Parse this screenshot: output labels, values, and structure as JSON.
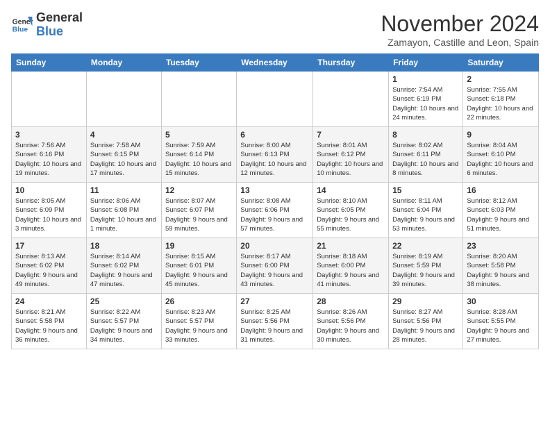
{
  "logo": {
    "line1": "General",
    "line2": "Blue"
  },
  "title": "November 2024",
  "location": "Zamayon, Castille and Leon, Spain",
  "days_of_week": [
    "Sunday",
    "Monday",
    "Tuesday",
    "Wednesday",
    "Thursday",
    "Friday",
    "Saturday"
  ],
  "weeks": [
    [
      {
        "day": "",
        "info": ""
      },
      {
        "day": "",
        "info": ""
      },
      {
        "day": "",
        "info": ""
      },
      {
        "day": "",
        "info": ""
      },
      {
        "day": "",
        "info": ""
      },
      {
        "day": "1",
        "info": "Sunrise: 7:54 AM\nSunset: 6:19 PM\nDaylight: 10 hours and 24 minutes."
      },
      {
        "day": "2",
        "info": "Sunrise: 7:55 AM\nSunset: 6:18 PM\nDaylight: 10 hours and 22 minutes."
      }
    ],
    [
      {
        "day": "3",
        "info": "Sunrise: 7:56 AM\nSunset: 6:16 PM\nDaylight: 10 hours and 19 minutes."
      },
      {
        "day": "4",
        "info": "Sunrise: 7:58 AM\nSunset: 6:15 PM\nDaylight: 10 hours and 17 minutes."
      },
      {
        "day": "5",
        "info": "Sunrise: 7:59 AM\nSunset: 6:14 PM\nDaylight: 10 hours and 15 minutes."
      },
      {
        "day": "6",
        "info": "Sunrise: 8:00 AM\nSunset: 6:13 PM\nDaylight: 10 hours and 12 minutes."
      },
      {
        "day": "7",
        "info": "Sunrise: 8:01 AM\nSunset: 6:12 PM\nDaylight: 10 hours and 10 minutes."
      },
      {
        "day": "8",
        "info": "Sunrise: 8:02 AM\nSunset: 6:11 PM\nDaylight: 10 hours and 8 minutes."
      },
      {
        "day": "9",
        "info": "Sunrise: 8:04 AM\nSunset: 6:10 PM\nDaylight: 10 hours and 6 minutes."
      }
    ],
    [
      {
        "day": "10",
        "info": "Sunrise: 8:05 AM\nSunset: 6:09 PM\nDaylight: 10 hours and 3 minutes."
      },
      {
        "day": "11",
        "info": "Sunrise: 8:06 AM\nSunset: 6:08 PM\nDaylight: 10 hours and 1 minute."
      },
      {
        "day": "12",
        "info": "Sunrise: 8:07 AM\nSunset: 6:07 PM\nDaylight: 9 hours and 59 minutes."
      },
      {
        "day": "13",
        "info": "Sunrise: 8:08 AM\nSunset: 6:06 PM\nDaylight: 9 hours and 57 minutes."
      },
      {
        "day": "14",
        "info": "Sunrise: 8:10 AM\nSunset: 6:05 PM\nDaylight: 9 hours and 55 minutes."
      },
      {
        "day": "15",
        "info": "Sunrise: 8:11 AM\nSunset: 6:04 PM\nDaylight: 9 hours and 53 minutes."
      },
      {
        "day": "16",
        "info": "Sunrise: 8:12 AM\nSunset: 6:03 PM\nDaylight: 9 hours and 51 minutes."
      }
    ],
    [
      {
        "day": "17",
        "info": "Sunrise: 8:13 AM\nSunset: 6:02 PM\nDaylight: 9 hours and 49 minutes."
      },
      {
        "day": "18",
        "info": "Sunrise: 8:14 AM\nSunset: 6:02 PM\nDaylight: 9 hours and 47 minutes."
      },
      {
        "day": "19",
        "info": "Sunrise: 8:15 AM\nSunset: 6:01 PM\nDaylight: 9 hours and 45 minutes."
      },
      {
        "day": "20",
        "info": "Sunrise: 8:17 AM\nSunset: 6:00 PM\nDaylight: 9 hours and 43 minutes."
      },
      {
        "day": "21",
        "info": "Sunrise: 8:18 AM\nSunset: 6:00 PM\nDaylight: 9 hours and 41 minutes."
      },
      {
        "day": "22",
        "info": "Sunrise: 8:19 AM\nSunset: 5:59 PM\nDaylight: 9 hours and 39 minutes."
      },
      {
        "day": "23",
        "info": "Sunrise: 8:20 AM\nSunset: 5:58 PM\nDaylight: 9 hours and 38 minutes."
      }
    ],
    [
      {
        "day": "24",
        "info": "Sunrise: 8:21 AM\nSunset: 5:58 PM\nDaylight: 9 hours and 36 minutes."
      },
      {
        "day": "25",
        "info": "Sunrise: 8:22 AM\nSunset: 5:57 PM\nDaylight: 9 hours and 34 minutes."
      },
      {
        "day": "26",
        "info": "Sunrise: 8:23 AM\nSunset: 5:57 PM\nDaylight: 9 hours and 33 minutes."
      },
      {
        "day": "27",
        "info": "Sunrise: 8:25 AM\nSunset: 5:56 PM\nDaylight: 9 hours and 31 minutes."
      },
      {
        "day": "28",
        "info": "Sunrise: 8:26 AM\nSunset: 5:56 PM\nDaylight: 9 hours and 30 minutes."
      },
      {
        "day": "29",
        "info": "Sunrise: 8:27 AM\nSunset: 5:56 PM\nDaylight: 9 hours and 28 minutes."
      },
      {
        "day": "30",
        "info": "Sunrise: 8:28 AM\nSunset: 5:55 PM\nDaylight: 9 hours and 27 minutes."
      }
    ]
  ]
}
